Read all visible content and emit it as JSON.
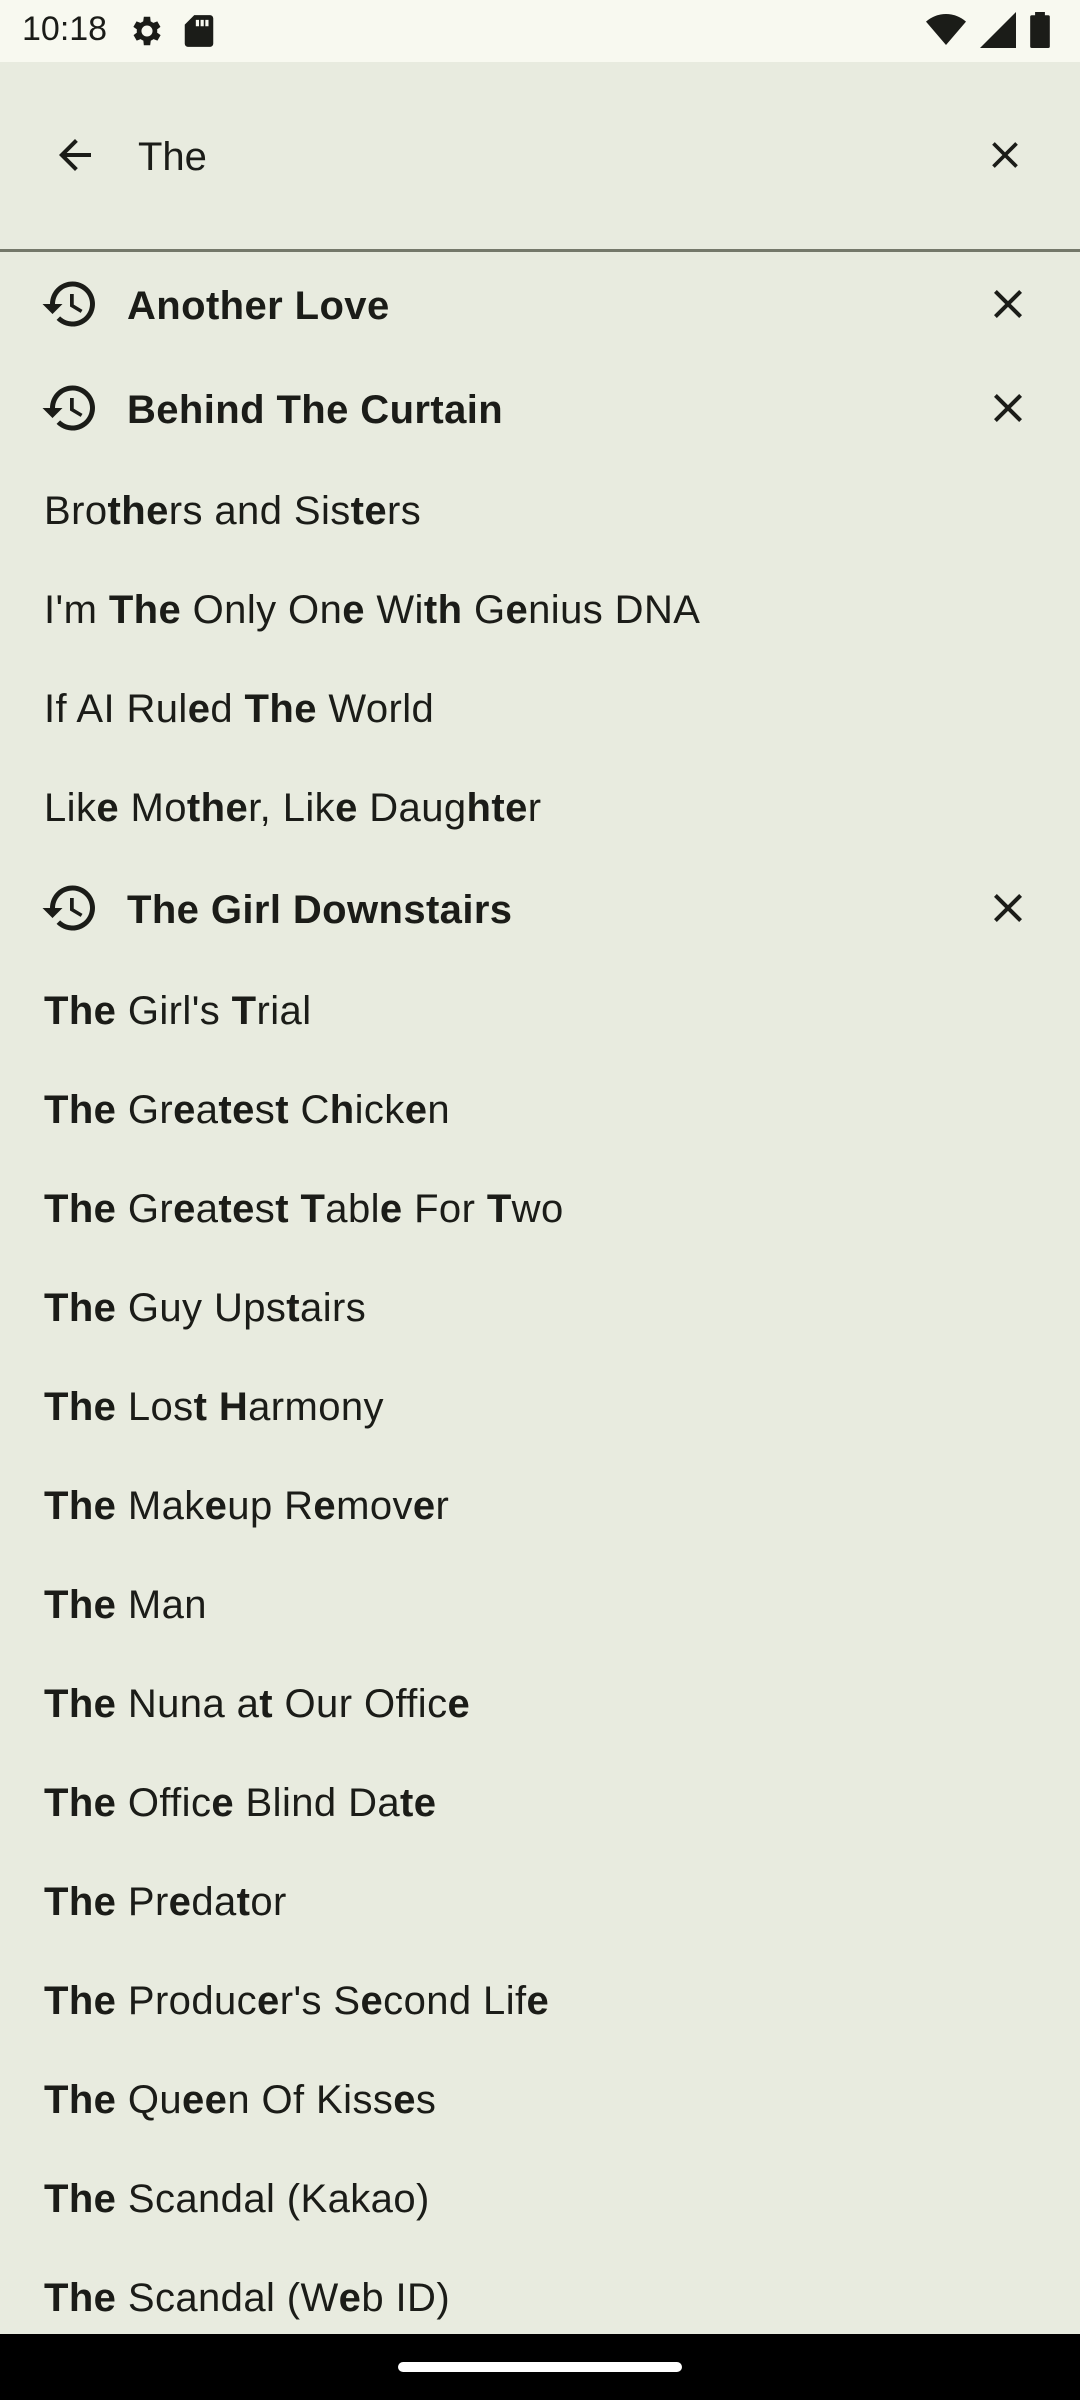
{
  "status_bar": {
    "time": "10:18",
    "icons": [
      "settings-icon",
      "sd-card-icon",
      "wifi-icon",
      "signal-icon",
      "battery-icon"
    ]
  },
  "search": {
    "query": "The",
    "back_icon": "arrow-back-icon",
    "clear_icon": "close-icon"
  },
  "suggestions": [
    {
      "type": "history",
      "text": "Another Love"
    },
    {
      "type": "history",
      "text": "Behind The Curtain"
    },
    {
      "type": "suggestion",
      "text": "Brothers and Sisters"
    },
    {
      "type": "suggestion",
      "text": "I'm The Only One With Genius DNA"
    },
    {
      "type": "suggestion",
      "text": "If AI Ruled The World"
    },
    {
      "type": "suggestion",
      "text": "Like Mother, Like Daughter"
    },
    {
      "type": "history",
      "text": "The Girl Downstairs"
    },
    {
      "type": "suggestion",
      "text": "The Girl's Trial"
    },
    {
      "type": "suggestion",
      "text": "The Greatest Chicken"
    },
    {
      "type": "suggestion",
      "text": "The Greatest Table For Two"
    },
    {
      "type": "suggestion",
      "text": "The Guy Upstairs"
    },
    {
      "type": "suggestion",
      "text": "The Lost Harmony"
    },
    {
      "type": "suggestion",
      "text": "The Makeup Remover"
    },
    {
      "type": "suggestion",
      "text": "The Man"
    },
    {
      "type": "suggestion",
      "text": "The Nuna at Our Office"
    },
    {
      "type": "suggestion",
      "text": "The Office Blind Date"
    },
    {
      "type": "suggestion",
      "text": "The Predator"
    },
    {
      "type": "suggestion",
      "text": "The Producer's Second Life"
    },
    {
      "type": "suggestion",
      "text": "The Queen Of Kisses"
    },
    {
      "type": "suggestion",
      "text": "The Scandal (Kakao)"
    },
    {
      "type": "suggestion",
      "text": "The Scandal (Web ID)"
    }
  ],
  "colors": {
    "background": "#e8ebdf",
    "status_bar": "#f8f9f0",
    "text": "#1b1c18",
    "divider": "#74786a",
    "nav_bar": "#000000"
  }
}
